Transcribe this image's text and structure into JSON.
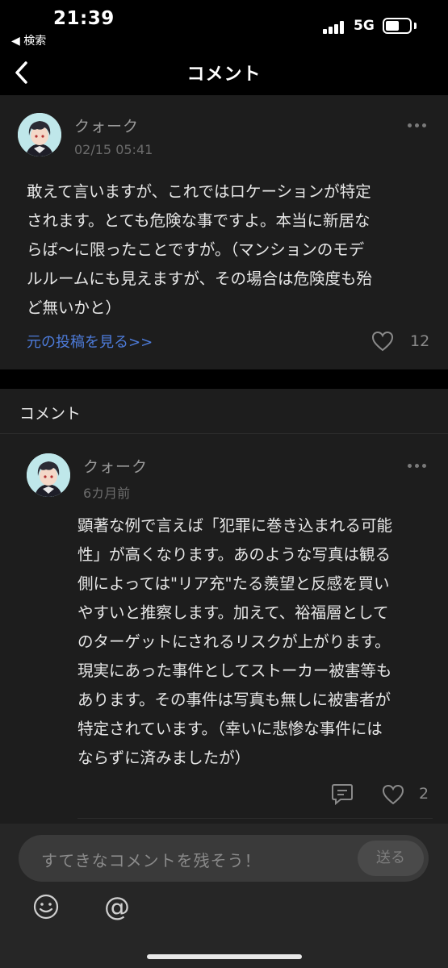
{
  "status_bar": {
    "time": "21:39",
    "back_label": "◀ 検索",
    "network": "5G"
  },
  "nav": {
    "title": "コメント"
  },
  "post": {
    "username": "クォーク",
    "timestamp": "02/15 05:41",
    "lines": [
      "敢えて言いますが、これではロケーションが特定",
      "されます。とても危険な事ですよ。本当に新居な",
      "らば〜に限ったことですが。（マンションのモデ",
      "ルルームにも見えますが、その場合は危険度も殆",
      "ど無いかと）"
    ],
    "view_original_label": "元の投稿を見る>>",
    "like_count": "12"
  },
  "comments": {
    "header": "コメント",
    "items": [
      {
        "username": "クォーク",
        "timestamp": "6カ月前",
        "lines": [
          "顕著な例で言えば「犯罪に巻き込まれる可能",
          "性」が高くなります。あのような写真は観る",
          "側によっては\"リア充\"たる羨望と反感を買い",
          "やすいと推察します。加えて、裕福層として",
          "のターゲットにされるリスクが上がります。",
          "現実にあった事件としてストーカー被害等も",
          "あります。その事件は写真も無しに被害者が",
          "特定されています。（幸いに悲惨な事件には",
          "ならずに済みましたが）"
        ],
        "like_count": "2"
      }
    ]
  },
  "input": {
    "placeholder": "すてきなコメントを残そう！",
    "send_label": "送る"
  }
}
